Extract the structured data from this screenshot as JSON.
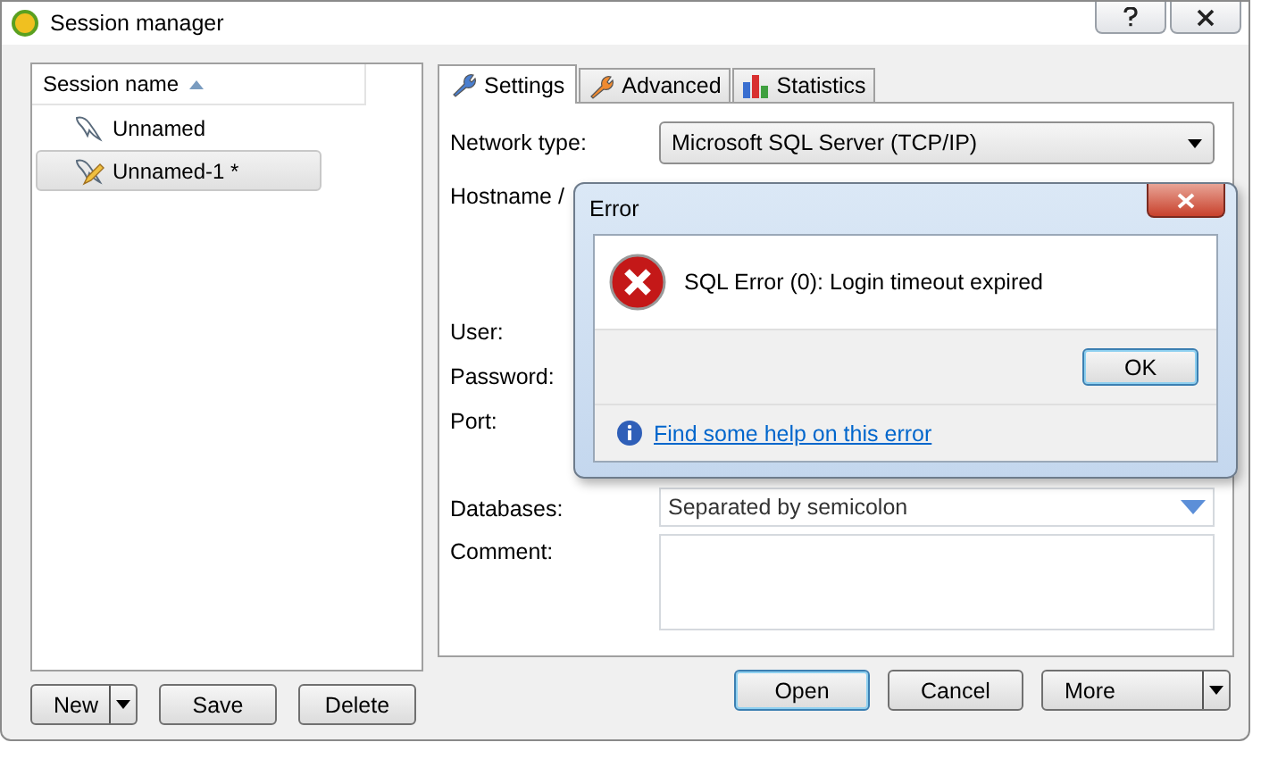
{
  "window": {
    "title": "Session manager"
  },
  "sessions": {
    "column": "Session name",
    "items": [
      {
        "name": "Unnamed",
        "selected": false,
        "modified": false
      },
      {
        "name": "Unnamed-1 *",
        "selected": true,
        "modified": true
      }
    ]
  },
  "session_buttons": [
    {
      "label": "New",
      "kind": "split"
    },
    {
      "label": "Save",
      "kind": "plain"
    },
    {
      "label": "Delete",
      "kind": "plain"
    }
  ],
  "tabs": [
    {
      "label": "Settings",
      "selected": true,
      "kind": "wrench",
      "color": "#4a7fd0"
    },
    {
      "label": "Advanced",
      "selected": false,
      "kind": "wrench",
      "color": "#f08a30"
    },
    {
      "label": "Statistics",
      "selected": false,
      "kind": "chart",
      "color": "#3a6fd0"
    }
  ],
  "form": [
    {
      "kind": "select",
      "label": "Network type:",
      "value": "Microsoft SQL Server (TCP/IP)"
    },
    {
      "kind": "host",
      "label": "Hostname /"
    },
    {
      "kind": "text",
      "label": "User:"
    },
    {
      "kind": "text",
      "label": "Password:"
    },
    {
      "kind": "port",
      "label": "Port:"
    },
    {
      "kind": "combo",
      "label": "Databases:",
      "placeholder": "Separated by semicolon"
    },
    {
      "kind": "memo",
      "label": "Comment:"
    }
  ],
  "dialog_buttons": [
    {
      "label": "Open",
      "kind": "default"
    },
    {
      "label": "Cancel",
      "kind": "plain"
    },
    {
      "label": "More",
      "kind": "split"
    }
  ],
  "error": {
    "title": "Error",
    "message": "SQL Error (0): Login timeout expired",
    "button": "OK",
    "link": "Find some help on this error"
  }
}
